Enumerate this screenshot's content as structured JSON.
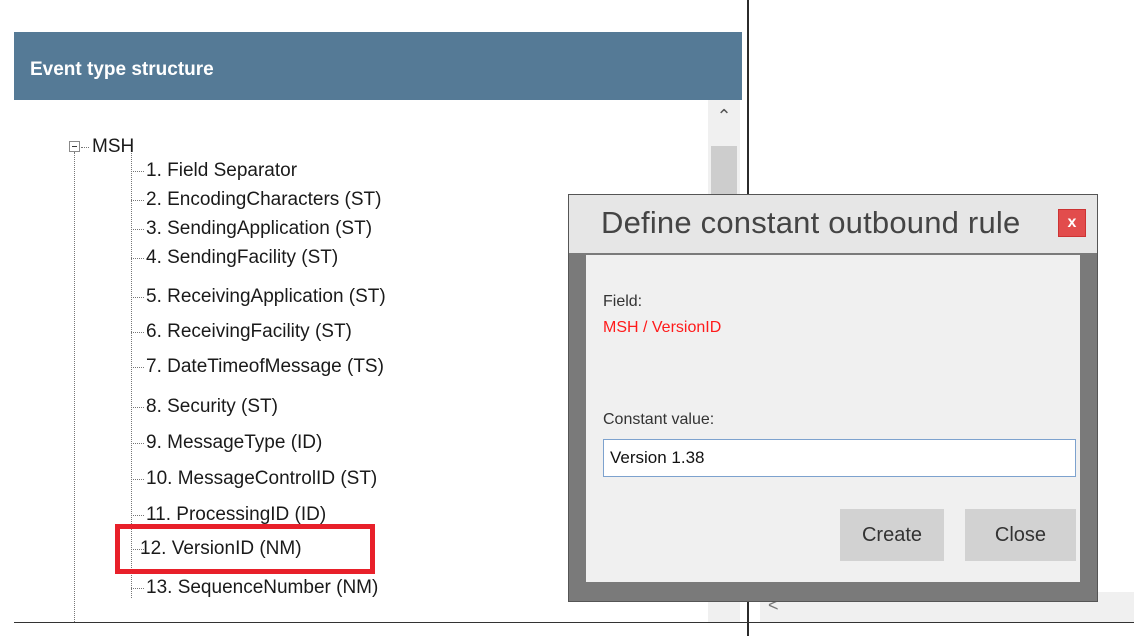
{
  "panel": {
    "title": "Event type structure",
    "root_label": "MSH",
    "items": [
      "1. Field Separator",
      "2. EncodingCharacters (ST)",
      "3. SendingApplication (ST)",
      "4. SendingFacility (ST)",
      "5. ReceivingApplication (ST)",
      "6. ReceivingFacility (ST)",
      "7. DateTimeofMessage (TS)",
      "8. Security (ST)",
      "9. MessageType (ID)",
      "10. MessageControlID (ST)",
      "11. ProcessingID (ID)",
      "12. VersionID (NM)",
      "13. SequenceNumber (NM)"
    ],
    "highlighted_item_index": 11
  },
  "dialog": {
    "title": "Define constant outbound rule",
    "close_label": "x",
    "field_label": "Field:",
    "field_value": "MSH / VersionID",
    "constant_label": "Constant value:",
    "constant_value": "Version 1.38",
    "create_label": "Create",
    "close_button_label": "Close"
  },
  "colors": {
    "header_bg": "#557a96",
    "highlight": "#e8202a",
    "field_value": "#ff1a1a",
    "close_button": "#e24c4c"
  }
}
